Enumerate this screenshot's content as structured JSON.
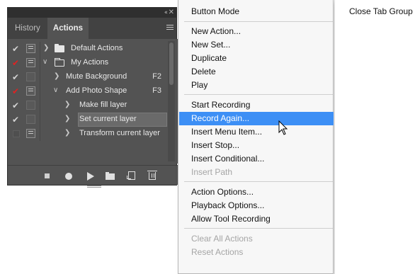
{
  "panel": {
    "tabs": [
      {
        "label": "History"
      },
      {
        "label": "Actions"
      }
    ],
    "collapse_glyph": "‹‹",
    "close_glyph": "✕",
    "rows": [
      {
        "label": "Default Actions",
        "fkey": "",
        "check_red": false
      },
      {
        "label": "My Actions",
        "fkey": "",
        "check_red": true
      },
      {
        "label": "Mute Background",
        "fkey": "F2",
        "check_red": false
      },
      {
        "label": "Add Photo Shape",
        "fkey": "F3",
        "check_red": true
      },
      {
        "label": "Make fill layer",
        "fkey": "",
        "check_red": false
      },
      {
        "label": "Set current layer",
        "fkey": "",
        "check_red": false
      },
      {
        "label": "Transform current layer",
        "fkey": "",
        "check_red": false
      }
    ],
    "glyphs": {
      "check": "✔",
      "chevron_right": "❯",
      "chevron_down": "∨"
    }
  },
  "menu": {
    "items": [
      {
        "label": "Button Mode"
      },
      {
        "label": "New Action..."
      },
      {
        "label": "New Set..."
      },
      {
        "label": "Duplicate"
      },
      {
        "label": "Delete"
      },
      {
        "label": "Play"
      },
      {
        "label": "Start Recording"
      },
      {
        "label": "Record Again..."
      },
      {
        "label": "Insert Menu Item..."
      },
      {
        "label": "Insert Stop..."
      },
      {
        "label": "Insert Conditional..."
      },
      {
        "label": "Insert Path"
      },
      {
        "label": "Action Options..."
      },
      {
        "label": "Playback Options..."
      },
      {
        "label": "Allow Tool Recording"
      },
      {
        "label": "Clear All Actions"
      },
      {
        "label": "Reset Actions"
      }
    ]
  },
  "menu2": {
    "items": [
      {
        "label": "Close Tab Group"
      }
    ]
  },
  "colors": {
    "panel_bg": "#535353",
    "highlight": "#3d8ff5",
    "record_check": "#e02222"
  }
}
